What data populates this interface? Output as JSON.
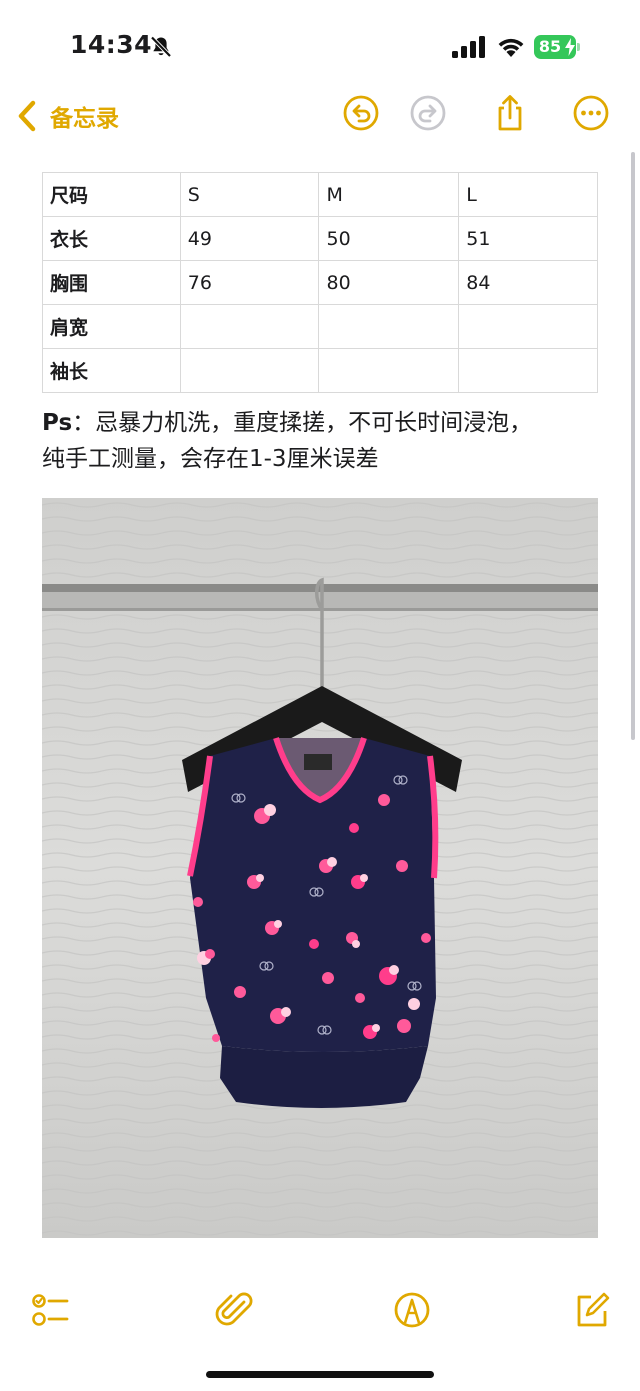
{
  "status_bar": {
    "time": "14:34",
    "battery_level": "85",
    "icons": [
      "bell-slash-icon",
      "cellular-signal-icon",
      "wifi-icon",
      "battery-charging-icon"
    ]
  },
  "nav": {
    "back_label": "备忘录",
    "icons": [
      "chevron-left-icon",
      "undo-icon",
      "redo-icon",
      "share-icon",
      "more-icon"
    ],
    "accent_color": "#e0a800",
    "disabled_color": "#c7c7cc"
  },
  "table": {
    "rows": [
      [
        "尺码",
        "S",
        "M",
        "L"
      ],
      [
        "衣长",
        "49",
        "50",
        "51"
      ],
      [
        "胸围",
        "76",
        "80",
        "84"
      ],
      [
        "肩宽",
        "",
        "",
        ""
      ],
      [
        "袖长",
        "",
        "",
        ""
      ]
    ]
  },
  "note": {
    "ps_label": "Ps",
    "line1": "：忌暴力机洗，重度揉搓，不可长时间浸泡，",
    "line2": "纯手工测量，会存在1-3厘米误差"
  },
  "photo": {
    "subject": "navy sleeveless knit vest with pink floral pattern on hanger",
    "colors": {
      "vest": "#1f2148",
      "trim": "#ff3d8b",
      "wall": "#d8d8d6"
    }
  },
  "toolbar": {
    "icons": [
      "checklist-icon",
      "paperclip-icon",
      "markup-icon",
      "compose-icon"
    ]
  }
}
